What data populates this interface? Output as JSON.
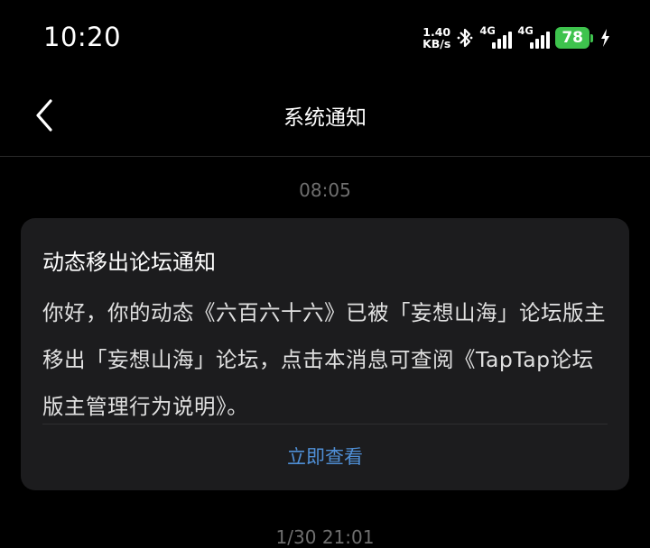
{
  "status_bar": {
    "time": "10:20",
    "net_speed_value": "1.40",
    "net_speed_unit": "KB/s",
    "sim1_label": "4G",
    "sim2_label": "4G",
    "battery_level": "78",
    "battery_color": "#3ec34d",
    "icons": [
      "bluetooth-icon",
      "signal-icon",
      "charging-icon"
    ]
  },
  "header": {
    "title": "系统通知",
    "back_icon": "chevron-left-icon"
  },
  "messages": [
    {
      "timestamp": "08:05",
      "title": "动态移出论坛通知",
      "body": "你好，你的动态《六百六十六》已被「妄想山海」论坛版主移出「妄想山海」论坛，点击本消息可查阅《TapTap论坛版主管理行为说明》。",
      "action_label": "立即查看",
      "action_color": "#4f8fd6"
    }
  ],
  "next_timestamp": "1/30 21:01"
}
